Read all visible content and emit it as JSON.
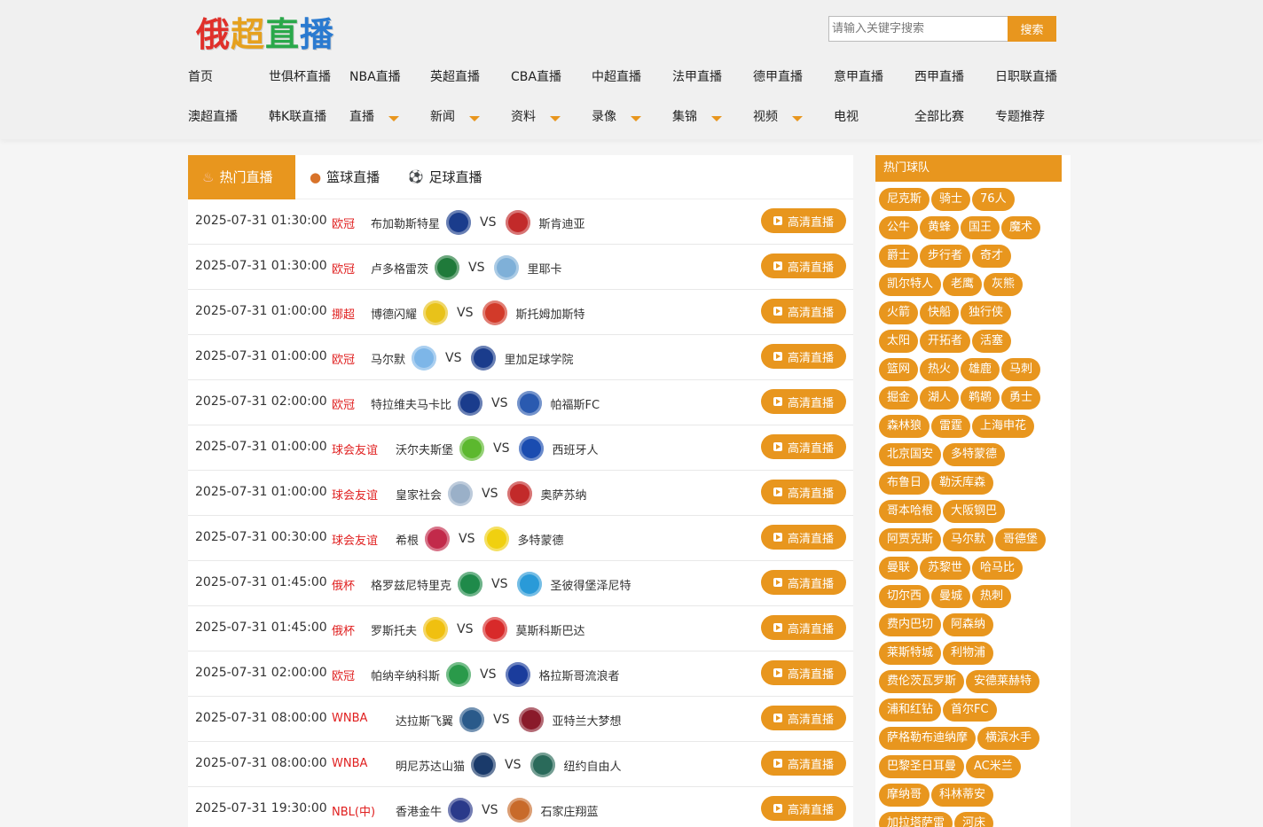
{
  "site": {
    "logo_chars": [
      {
        "ch": "俄",
        "color": "#e0302a"
      },
      {
        "ch": "超",
        "color": "#e6a11e"
      },
      {
        "ch": "直",
        "color": "#2aa84a"
      },
      {
        "ch": "播",
        "color": "#2a7ad0"
      }
    ]
  },
  "search": {
    "placeholder": "请输入关键字搜索",
    "button": "搜索"
  },
  "nav": {
    "row1": [
      "首页",
      "世俱杯直播",
      "NBA直播",
      "英超直播",
      "CBA直播",
      "中超直播",
      "法甲直播",
      "德甲直播",
      "意甲直播",
      "西甲直播",
      "日职联直播"
    ],
    "row2": [
      {
        "label": "澳超直播",
        "dropdown": false
      },
      {
        "label": "韩K联直播",
        "dropdown": false
      },
      {
        "label": "直播",
        "dropdown": true
      },
      {
        "label": "新闻",
        "dropdown": true
      },
      {
        "label": "资料",
        "dropdown": true
      },
      {
        "label": "录像",
        "dropdown": true
      },
      {
        "label": "集锦",
        "dropdown": true
      },
      {
        "label": "视频",
        "dropdown": true
      },
      {
        "label": "电视",
        "dropdown": false
      },
      {
        "label": "全部比赛",
        "dropdown": false
      },
      {
        "label": "专题推荐",
        "dropdown": false
      }
    ]
  },
  "tabs": [
    {
      "label": "热门直播",
      "icon": "flame-icon",
      "active": true
    },
    {
      "label": "篮球直播",
      "icon": "basketball-icon",
      "active": false
    },
    {
      "label": "足球直播",
      "icon": "soccer-ball-icon",
      "active": false
    }
  ],
  "matches": [
    {
      "time": "2025-07-31 01:30:00",
      "league": "欧冠",
      "home": "布加勒斯特星",
      "away": "斯肯迪亚",
      "home_color": "#1a3c8c",
      "away_color": "#c22a2a",
      "button": "高清直播"
    },
    {
      "time": "2025-07-31 01:30:00",
      "league": "欧冠",
      "home": "卢多格雷茨",
      "away": "里耶卡",
      "home_color": "#1f7a3a",
      "away_color": "#7fb0d8",
      "button": "高清直播"
    },
    {
      "time": "2025-07-31 01:00:00",
      "league": "挪超",
      "home": "博德闪耀",
      "away": "斯托姆加斯特",
      "home_color": "#e8c21a",
      "away_color": "#d23a2a",
      "button": "高清直播"
    },
    {
      "time": "2025-07-31 01:00:00",
      "league": "欧冠",
      "home": "马尔默",
      "away": "里加足球学院",
      "home_color": "#7db6e8",
      "away_color": "#1a3c8c",
      "button": "高清直播"
    },
    {
      "time": "2025-07-31 02:00:00",
      "league": "欧冠",
      "home": "特拉维夫马卡比",
      "away": "帕福斯FC",
      "home_color": "#1a3c8c",
      "away_color": "#2a5ab0",
      "button": "高清直播"
    },
    {
      "time": "2025-07-31 01:00:00",
      "league": "球会友谊",
      "home": "沃尔夫斯堡",
      "away": "西班牙人",
      "home_color": "#5cb82e",
      "away_color": "#1a4cb0",
      "button": "高清直播"
    },
    {
      "time": "2025-07-31 01:00:00",
      "league": "球会友谊",
      "home": "皇家社会",
      "away": "奥萨苏纳",
      "home_color": "#9ab0c8",
      "away_color": "#c22a2a",
      "button": "高清直播"
    },
    {
      "time": "2025-07-31 00:30:00",
      "league": "球会友谊",
      "home": "希根",
      "away": "多特蒙德",
      "home_color": "#c22a4a",
      "away_color": "#f0d010",
      "button": "高清直播"
    },
    {
      "time": "2025-07-31 01:45:00",
      "league": "俄杯",
      "home": "格罗兹尼特里克",
      "away": "圣彼得堡泽尼特",
      "home_color": "#1f8a4a",
      "away_color": "#2a9ad8",
      "button": "高清直播"
    },
    {
      "time": "2025-07-31 01:45:00",
      "league": "俄杯",
      "home": "罗斯托夫",
      "away": "莫斯科斯巴达",
      "home_color": "#f0c010",
      "away_color": "#d82a2a",
      "button": "高清直播"
    },
    {
      "time": "2025-07-31 02:00:00",
      "league": "欧冠",
      "home": "帕纳辛纳科斯",
      "away": "格拉斯哥流浪者",
      "home_color": "#2a9a4a",
      "away_color": "#1a3c9c",
      "button": "高清直播"
    },
    {
      "time": "2025-07-31 08:00:00",
      "league": "WNBA",
      "home": "达拉斯飞翼",
      "away": "亚特兰大梦想",
      "home_color": "#2a5a8a",
      "away_color": "#8a1a2a",
      "button": "高清直播"
    },
    {
      "time": "2025-07-31 08:00:00",
      "league": "WNBA",
      "home": "明尼苏达山猫",
      "away": "纽约自由人",
      "home_color": "#1a3a6a",
      "away_color": "#2a6a5a",
      "button": "高清直播"
    },
    {
      "time": "2025-07-31 19:30:00",
      "league": "NBL(中)",
      "home": "香港金牛",
      "away": "石家庄翔蓝",
      "home_color": "#2a3a8a",
      "away_color": "#c86a2a",
      "button": "高清直播"
    }
  ],
  "sidebar": {
    "title": "热门球队",
    "teams": [
      "尼克斯",
      "骑士",
      "76人",
      "公牛",
      "黄蜂",
      "国王",
      "魔术",
      "爵士",
      "步行者",
      "奇才",
      "凯尔特人",
      "老鹰",
      "灰熊",
      "火箭",
      "快船",
      "独行侠",
      "太阳",
      "开拓者",
      "活塞",
      "篮网",
      "热火",
      "雄鹿",
      "马刺",
      "掘金",
      "湖人",
      "鹈鹕",
      "勇士",
      "森林狼",
      "雷霆",
      "上海申花",
      "北京国安",
      "多特蒙德",
      "布鲁日",
      "勒沃库森",
      "哥本哈根",
      "大阪钢巴",
      "阿贾克斯",
      "马尔默",
      "哥德堡",
      "曼联",
      "苏黎世",
      "哈马比",
      "切尔西",
      "曼城",
      "热刺",
      "费内巴切",
      "阿森纳",
      "莱斯特城",
      "利物浦",
      "费伦茨瓦罗斯",
      "安德莱赫特",
      "浦和红钻",
      "首尔FC",
      "萨格勒布迪纳摩",
      "横滨水手",
      "巴黎圣日耳曼",
      "AC米兰",
      "摩纳哥",
      "科林蒂安",
      "加拉塔萨雷",
      "河床"
    ]
  },
  "colors": {
    "accent": "#e8961e",
    "league_text": "#e02020"
  }
}
